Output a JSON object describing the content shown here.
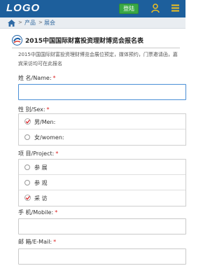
{
  "header": {
    "logo": "LOGO",
    "login_label": "登陆",
    "colors": {
      "bar": "#1d5f9c",
      "login": "#39a845",
      "icons": "#f0c020"
    }
  },
  "breadcrumb": {
    "items": [
      "产品",
      "展会"
    ],
    "separator": ">"
  },
  "form": {
    "title": "2015中国国际财富投资理财博览会报名表",
    "description": "2015中国国际财富投资理财博览会展位预定，媒体预约，门票邀请函，嘉宾采访均可在此报名",
    "required_mark": "*",
    "fields": {
      "name": {
        "label": "姓 名/Name:",
        "value": ""
      },
      "sex": {
        "label": "性 别/Sex:",
        "options": [
          {
            "label": "男/Men:",
            "selected": true
          },
          {
            "label": "女/women:",
            "selected": false
          }
        ]
      },
      "project": {
        "label": "项 目/Project:",
        "options": [
          {
            "label": "参 展",
            "checked": false
          },
          {
            "label": "参 观",
            "checked": false
          },
          {
            "label": "采 访",
            "checked": true
          }
        ]
      },
      "mobile": {
        "label": "手 机/Mobile:",
        "value": ""
      },
      "email": {
        "label": "邮 箱/E-Mail:",
        "value": ""
      }
    }
  }
}
